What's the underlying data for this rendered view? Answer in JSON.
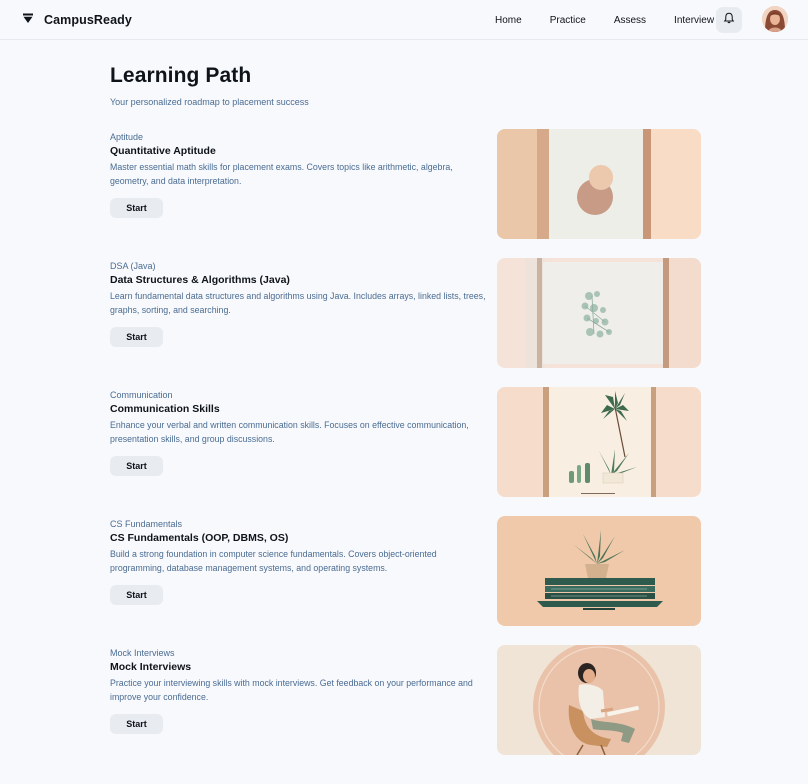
{
  "header": {
    "brand": "CampusReady",
    "nav": [
      "Home",
      "Practice",
      "Assess",
      "Interview"
    ]
  },
  "page": {
    "title": "Learning Path",
    "subtitle": "Your personalized roadmap to placement success"
  },
  "modules": [
    {
      "category": "Aptitude",
      "title": "Quantitative Aptitude",
      "description": "Master essential math skills for placement exams. Covers topics like arithmetic, algebra, geometry, and data interpretation.",
      "button": "Start"
    },
    {
      "category": "DSA (Java)",
      "title": "Data Structures & Algorithms (Java)",
      "description": "Learn fundamental data structures and algorithms using Java. Includes arrays, linked lists, trees, graphs, sorting, and searching.",
      "button": "Start"
    },
    {
      "category": "Communication",
      "title": "Communication Skills",
      "description": "Enhance your verbal and written communication skills. Focuses on effective communication, presentation skills, and group discussions.",
      "button": "Start"
    },
    {
      "category": "CS Fundamentals",
      "title": "CS Fundamentals (OOP, DBMS, OS)",
      "description": "Build a strong foundation in computer science fundamentals. Covers object-oriented programming, database management systems, and operating systems.",
      "button": "Start"
    },
    {
      "category": "Mock Interviews",
      "title": "Mock Interviews",
      "description": "Practice your interviewing skills with mock interviews. Get feedback on your performance and improve your confidence.",
      "button": "Start"
    }
  ],
  "icons": {
    "logo": "logo-icon",
    "notifications": "bell-icon",
    "profile": "avatar"
  },
  "colors": {
    "accent_text": "#4a6c93",
    "button_bg": "#e8ebf0",
    "background": "#f8f9fc"
  }
}
